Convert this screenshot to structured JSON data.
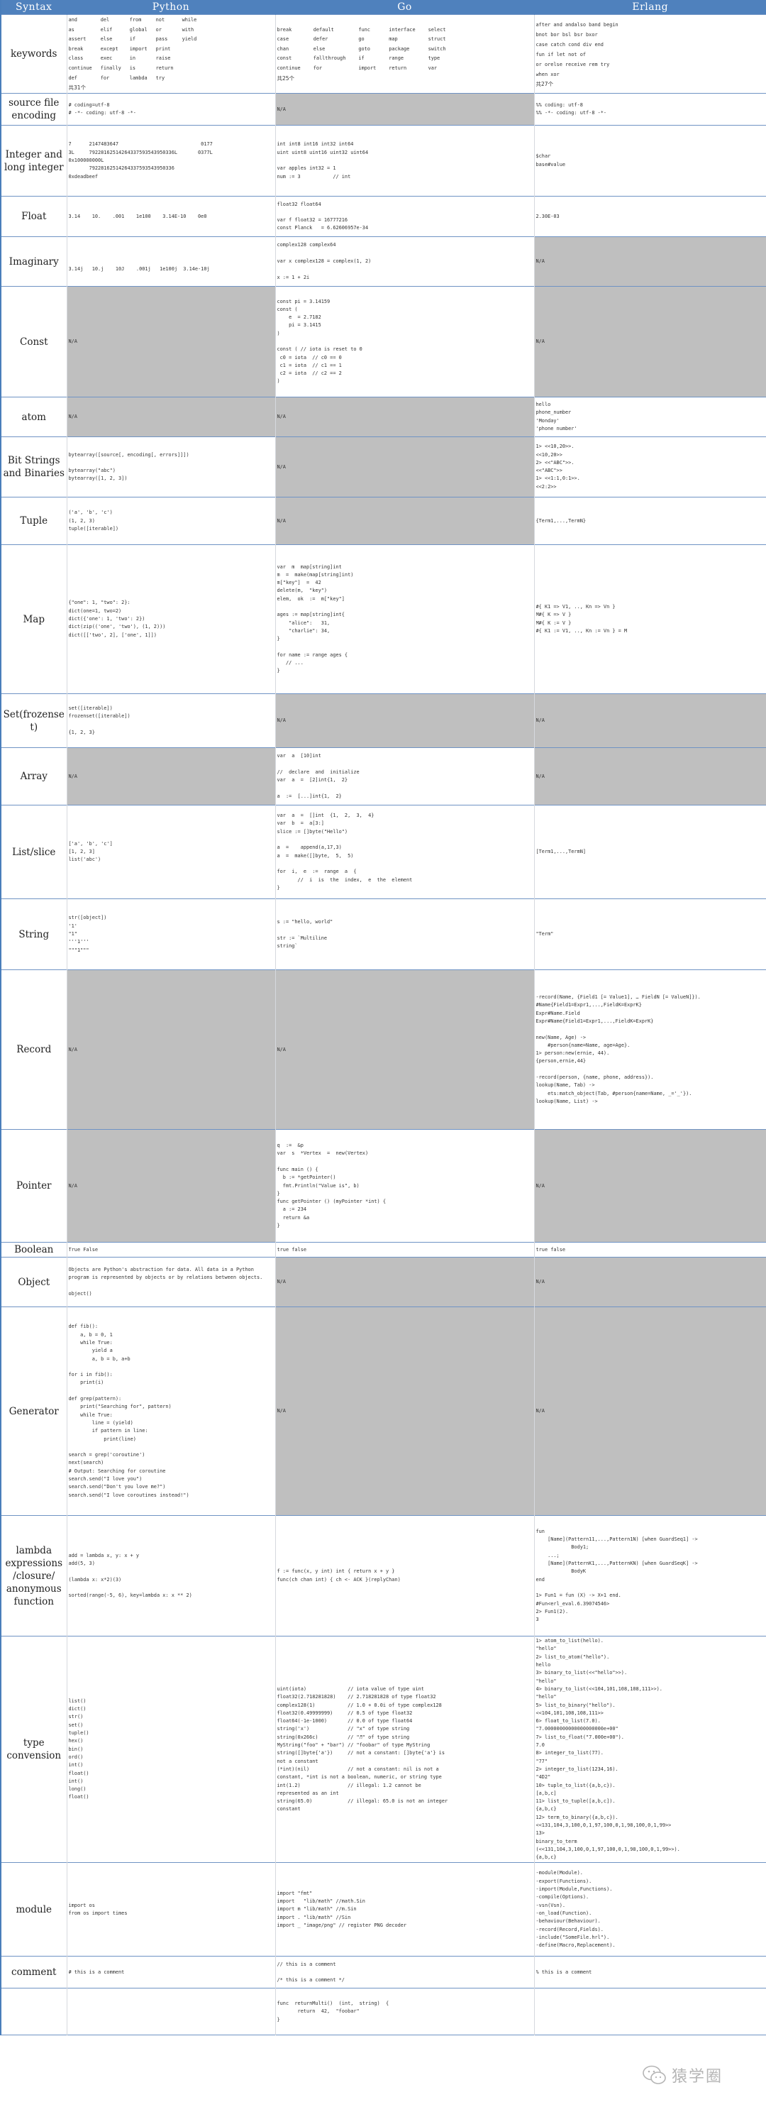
{
  "header": {
    "syntax": "Syntax",
    "python": "Python",
    "go": "Go",
    "erlang": "Erlang"
  },
  "keywords": {
    "label": "keywords",
    "python": [
      "and",
      "del",
      "from",
      "not",
      "while",
      "as",
      "elif",
      "global",
      "or",
      "with",
      "assert",
      "else",
      "if",
      "pass",
      "yield",
      "break",
      "except",
      "import",
      "print",
      "",
      "class",
      "exec",
      "in",
      "raise",
      "",
      "continue",
      "finally",
      "is",
      "return",
      "",
      "def",
      "for",
      "lambda",
      "try",
      ""
    ],
    "python_count": "共31个",
    "go": [
      "break",
      "default",
      "func",
      "interface",
      "select",
      "case",
      "defer",
      "go",
      "map",
      "struct",
      "chan",
      "else",
      "goto",
      "package",
      "switch",
      "const",
      "fallthrough",
      "if",
      "range",
      "type",
      "continue",
      "for",
      "import",
      "return",
      "var"
    ],
    "go_count": "共25个",
    "erlang": "after and andalso band begin\nbnot bor bsl bsr bxor\ncase catch cond div end\nfun if let not of\nor orelse receive rem try\nwhen xor",
    "erlang_count": "共27个"
  },
  "rows": [
    {
      "label": "source file encoding",
      "python": "# coding=utf-8\n# -*- coding: utf-8 -*-",
      "go": "N/A",
      "go_na": true,
      "erlang": "%% coding: utf-8\n%% -*- coding: utf-8 -*-"
    },
    {
      "label": "Integer and long integer",
      "python": "7      2147483647                            0177\n3L     79228162514264337593543950336L       0377L\n0x100000000L\n       79228162514264337593543950336\n0xdeadbeef",
      "go": "int int8 int16 int32 int64\nuint uint8 uint16 uint32 uint64\n\nvar apples int32 = 1\nnum := 3           // int",
      "erlang": "$char\nbase#value"
    },
    {
      "label": "Float",
      "python": "3.14    10.    .001    1e100    3.14E-10    0e0",
      "go": "float32 float64\n\nvar f float32 = 16777216\nconst Planck   = 6.62606957e-34",
      "erlang": "2.30E-03"
    },
    {
      "label": "Imaginary",
      "python": "\n\n3.14j   10.j    10J    .001j   1e100j  3.14e-10j",
      "go": "complex128 complex64\n\nvar x complex128 = complex(1, 2)\n\nx := 1 + 2i",
      "erlang": "N/A",
      "erlang_na": true
    },
    {
      "label": "Const",
      "python": "N/A",
      "python_na": true,
      "go": "const pi = 3.14159\nconst (\n    e  = 2.7182\n    pi = 3.1415\n)\n\nconst ( // iota is reset to 0\n c0 = iota  // c0 == 0\n c1 = iota  // c1 == 1\n c2 = iota  // c2 == 2\n)",
      "erlang": "N/A",
      "erlang_na": true
    },
    {
      "label": "atom",
      "python": "N/A",
      "python_na": true,
      "go": "N/A",
      "go_na": true,
      "erlang": "hello\nphone_number\n'Monday'\n'phone number'"
    },
    {
      "label": "Bit Strings and Binaries",
      "python": "bytearray([source[, encoding[, errors]]])\n\nbytearray(\"abc\")\nbytearray([1, 2, 3])",
      "go": "N/A",
      "go_na": true,
      "erlang": "1> <<10,20>>.\n<<10,20>>\n2> <<\"ABC\">>.\n<<\"ABC\">>\n1> <<1:1,0:1>>.\n<<2:2>>"
    },
    {
      "label": "Tuple",
      "python": "('a', 'b', 'c')\n(1, 2, 3)\ntuple([iterable])",
      "go": "N/A",
      "go_na": true,
      "erlang": "{Term1,...,TermN}"
    },
    {
      "label": "Map",
      "python": "{\"one\": 1, \"two\": 2}:\ndict(one=1, two=2)\ndict({'one': 1, 'two': 2})\ndict(zip(('one', 'two'), (1, 2)))\ndict([['two', 2], ['one', 1]])",
      "go": "var  m  map[string]int\nm  =  make(map[string]int)\nm[\"key\"]  =  42\ndelete(m,  \"key\")\nelem,  ok  :=  m[\"key\"]\n\nages := map[string]int{\n    \"alice\":   31,\n    \"charlie\": 34,\n}\n\nfor name := range ages {\n   // ...\n}",
      "erlang": "#{ K1 => V1, .., Kn => Vn }\nM#{ K => V }\nM#{ K := V }\n#{ K1 := V1, .., Kn := Vn } = M"
    },
    {
      "label": "Set(frozenset)",
      "python": "set([iterable])\nfrozenset([iterable])\n\n{1, 2, 3}",
      "go": "N/A",
      "go_na": true,
      "erlang": "N/A",
      "erlang_na": true
    },
    {
      "label": "Array",
      "python": "N/A",
      "python_na": true,
      "go": "var  a  [10]int\n\n//  declare  and  initialize\nvar  a  =  [2]int{1,  2}\n\na  :=  [...]int{1,  2}",
      "erlang": "N/A",
      "erlang_na": true
    },
    {
      "label": "List/slice",
      "python": "['a', 'b', 'c']\n[1, 2, 3]\nlist('abc')",
      "go": "var  a  =  []int  {1,  2,  3,  4}\nvar  b  =  a[3:]\nslice := []byte(\"Hello\")\n\na  =    append(a,17,3)\na  =  make([]byte,  5,  5)\n\nfor  i,  e  :=  range  a  {\n       //  i  is  the  index,  e  the  element\n}",
      "erlang": "[Term1,...,TermN]"
    },
    {
      "label": "String",
      "python": "str([object])\n'1'\n\"1\"\n'''1'''\n\"\"\"1\"\"\"",
      "go": "s := \"hello, world\"\n\nstr := `Multiline\nstring`",
      "erlang": "\"Term\""
    },
    {
      "label": "Record",
      "python": "N/A",
      "python_na": true,
      "go": "N/A",
      "go_na": true,
      "erlang": "-record(Name, {Field1 [= Value1], … FieldN [= ValueN]}).\n#Name{Field1=Expr1,...,FieldK=ExprK}\nExpr#Name.Field\nExpr#Name{Field1=Expr1,...,FieldK=ExprK}\n\nnew(Name, Age) ->\n    #person{name=Name, age=Age}.\n1> person:new(ernie, 44).\n{person,ernie,44}\n\n-record(person, {name, phone, address}).\nlookup(Name, Tab) ->\n    ets:match_object(Tab, #person{name=Name, _='_'}).\nlookup(Name, List) ->",
      "erlang_wrap": true
    },
    {
      "label": "Pointer",
      "python": "N/A",
      "python_na": true,
      "go": "q  :=  &p\nvar  s  *Vertex  =  new(Vertex)\n\nfunc main () {\n  b := *getPointer()\n  fmt.Println(\"Value is\", b)\n}\nfunc getPointer () (myPointer *int) {\n  a := 234\n  return &a\n}",
      "erlang": "N/A",
      "erlang_na": true
    },
    {
      "label": "Boolean",
      "python": "True False",
      "go": "true false",
      "erlang": "true false"
    },
    {
      "label": "Object",
      "python": "Objects are Python's abstraction for data. All data in a Python program is represented by objects or by relations between objects.\n\nobject()",
      "python_wrap": true,
      "go": "N/A",
      "go_na": true,
      "erlang": "N/A",
      "erlang_na": true
    },
    {
      "label": "Generator",
      "python": "def fib():\n    a, b = 0, 1\n    while True:\n        yield a\n        a, b = b, a+b\n\nfor i in fib():\n    print(i)\n\ndef grep(pattern):\n    print(\"Searching for\", pattern)\n    while True:\n        line = (yield)\n        if pattern in line:\n            print(line)\n\nsearch = grep('coroutine')\nnext(search)\n# Output: Searching for coroutine\nsearch.send(\"I love you\")\nsearch.send(\"Don't you love me?\")\nsearch.send(\"I love coroutines instead!\")",
      "go": "N/A",
      "go_na": true,
      "erlang": "N/A",
      "erlang_na": true
    },
    {
      "label": "lambda expressions /closure/ anonymous function",
      "python": "add = lambda x, y: x + y\nadd(5, 3)\n\n(lambda x: x*2)(3)\n\nsorted(range(-5, 6), key=lambda x: x ** 2)",
      "go": "f := func(x, y int) int { return x + y }\nfunc(ch chan int) { ch <- ACK }(replyChan)",
      "erlang": "fun\n    [Name](Pattern11,...,Pattern1N) [when GuardSeq1] ->\n            Body1;\n    ...;\n    [Name](PatternK1,...,PatternKN) [when GuardSeqK] ->\n            BodyK\nend\n\n1> Fun1 = fun (X) -> X+1 end.\n#Fun<erl_eval.6.39074546>\n2> Fun1(2).\n3"
    },
    {
      "label": "type convension",
      "python": "list()\ndict()\nstr()\nset()\ntuple()\nhex()\nbin()\nord()\nint()\nfloat()\nint()\nlong()\nfloat()",
      "go": "uint(iota)              // iota value of type uint\nfloat32(2.718281828)    // 2.718281828 of type float32\ncomplex128(1)           // 1.0 + 0.0i of type complex128\nfloat32(0.49999999)     // 0.5 of type float32\nfloat64(-1e-1000)       // 0.0 of type float64\nstring('x')             // \"x\" of type string\nstring(0x266c)          // \"♬\" of type string\nMyString(\"foo\" + \"bar\") // \"foobar\" of type MyString\nstring([]byte{'a'})     // not a constant: []byte{'a'} is\nnot a constant\n(*int)(nil)             // not a constant: nil is not a\nconstant, *int is not a boolean, numeric, or string type\nint(1.2)                // illegal: 1.2 cannot be\nrepresented as an int\nstring(65.0)            // illegal: 65.0 is not an integer\nconstant",
      "erlang": "1> atom_to_list(hello).\n\"hello\"\n2> list_to_atom(\"hello\").\nhello\n3> binary_to_list(<<\"hello\">>).\n\"hello\"\n4> binary_to_list(<<104,101,108,108,111>>).\n\"hello\"\n5> list_to_binary(\"hello\").\n<<104,101,108,108,111>>\n6> float_to_list(7.0).\n\"7.00000000000000000000e+00\"\n7> list_to_float(\"7.000e+00\").\n7.0\n8> integer_to_list(77).\n\"77\"\n2> integer_to_list(1234,16).\n\"4D2\"\n10> tuple_to_list({a,b,c}).\n[a,b,c]\n11> list_to_tuple([a,b,c]).\n{a,b,c}\n12> term_to_binary({a,b,c}).\n<<131,104,3,100,0,1,97,100,0,1,98,100,0,1,99>>\n13>\nbinary_to_term\n(<<131,104,3,100,0,1,97,100,0,1,98,100,0,1,99>>).\n{a,b,c}"
    },
    {
      "label": "module",
      "python": "import os\nfrom os import times",
      "go": "import \"fmt\"\nimport   \"lib/math\" //math.Sin\nimport m \"lib/math\" //m.Sin\nimport . \"lib/math\" //Sin\nimport _ \"image/png\" // register PNG decoder",
      "erlang": "-module(Module).\n-export(Functions).\n-import(Module,Functions).\n-compile(Options).\n-vsn(Vsn).\n-on_load(Function).\n-behaviour(Behaviour).\n-record(Record,Fields).\n-include(\"SomeFile.hrl\").\n-define(Macro,Replacement)."
    },
    {
      "label": "comment",
      "python": "# this is a comment",
      "go": "// this is a comment\n\n/* this is a comment */",
      "erlang": "% this is a comment"
    },
    {
      "label": "",
      "python": "",
      "go": "func  returnMulti()  (int,  string)  {\n       return  42,  \"foobar\"\n}",
      "erlang": ""
    }
  ],
  "watermark": {
    "text": "猿学圈",
    "icon": "wechat-icon"
  }
}
